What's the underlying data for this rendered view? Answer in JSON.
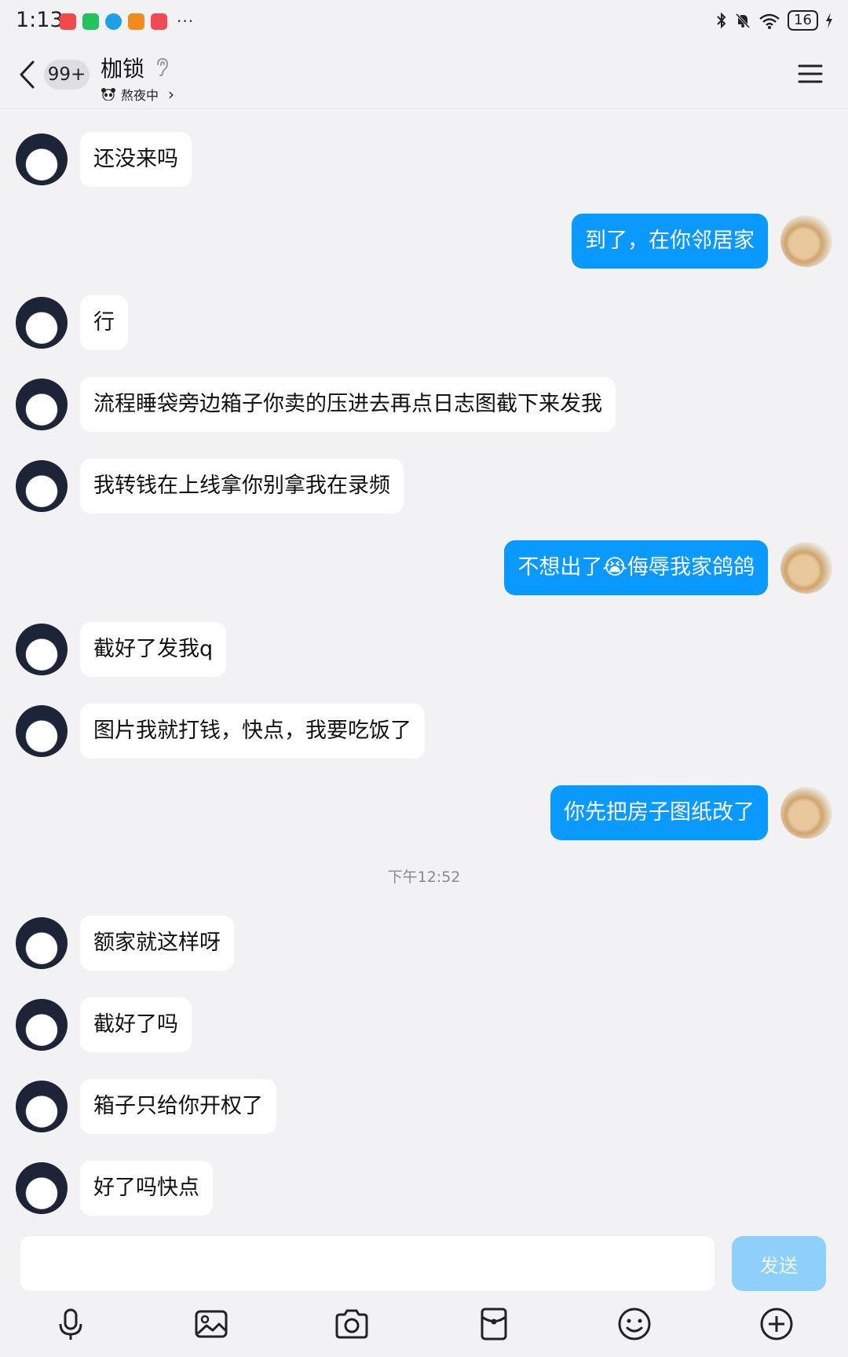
{
  "status_bar": {
    "time": "1:13",
    "battery": "16",
    "app_colors": [
      "#f04a4a",
      "#22c35e",
      "#1ea0e8",
      "#f58a1f",
      "#ef4b55"
    ]
  },
  "header": {
    "back_badge": "99+",
    "contact_name": "枷锁",
    "status_text": "熬夜中",
    "status_chevron": "›"
  },
  "messages": [
    {
      "side": "left",
      "text": "还没来吗"
    },
    {
      "side": "right",
      "text": "到了，在你邻居家"
    },
    {
      "side": "left",
      "text": "行"
    },
    {
      "side": "left",
      "text": "流程睡袋旁边箱子你卖的压进去再点日志图截下来发我"
    },
    {
      "side": "left",
      "text": "我转钱在上线拿你别拿我在录频"
    },
    {
      "side": "right",
      "text": "不想出了😭侮辱我家鸽鸽"
    },
    {
      "side": "left",
      "text": "截好了发我q"
    },
    {
      "side": "left",
      "text": "图片我就打钱，快点，我要吃饭了"
    },
    {
      "side": "right",
      "text": "你先把房子图纸改了"
    },
    {
      "side": "left",
      "text": "额家就这样呀"
    },
    {
      "side": "left",
      "text": "截好了吗"
    },
    {
      "side": "left",
      "text": "箱子只给你开权了"
    },
    {
      "side": "left",
      "text": "好了吗快点"
    }
  ],
  "time_separator": "下午12:52",
  "input": {
    "placeholder": "",
    "send_label": "发送"
  },
  "toolbar": [
    "mic-icon",
    "image-icon",
    "camera-icon",
    "red-packet-icon",
    "emoji-icon",
    "plus-icon"
  ],
  "colors": {
    "accent": "#0a99ff",
    "send_disabled": "#8fd0fb",
    "background": "#f2f2f4"
  }
}
